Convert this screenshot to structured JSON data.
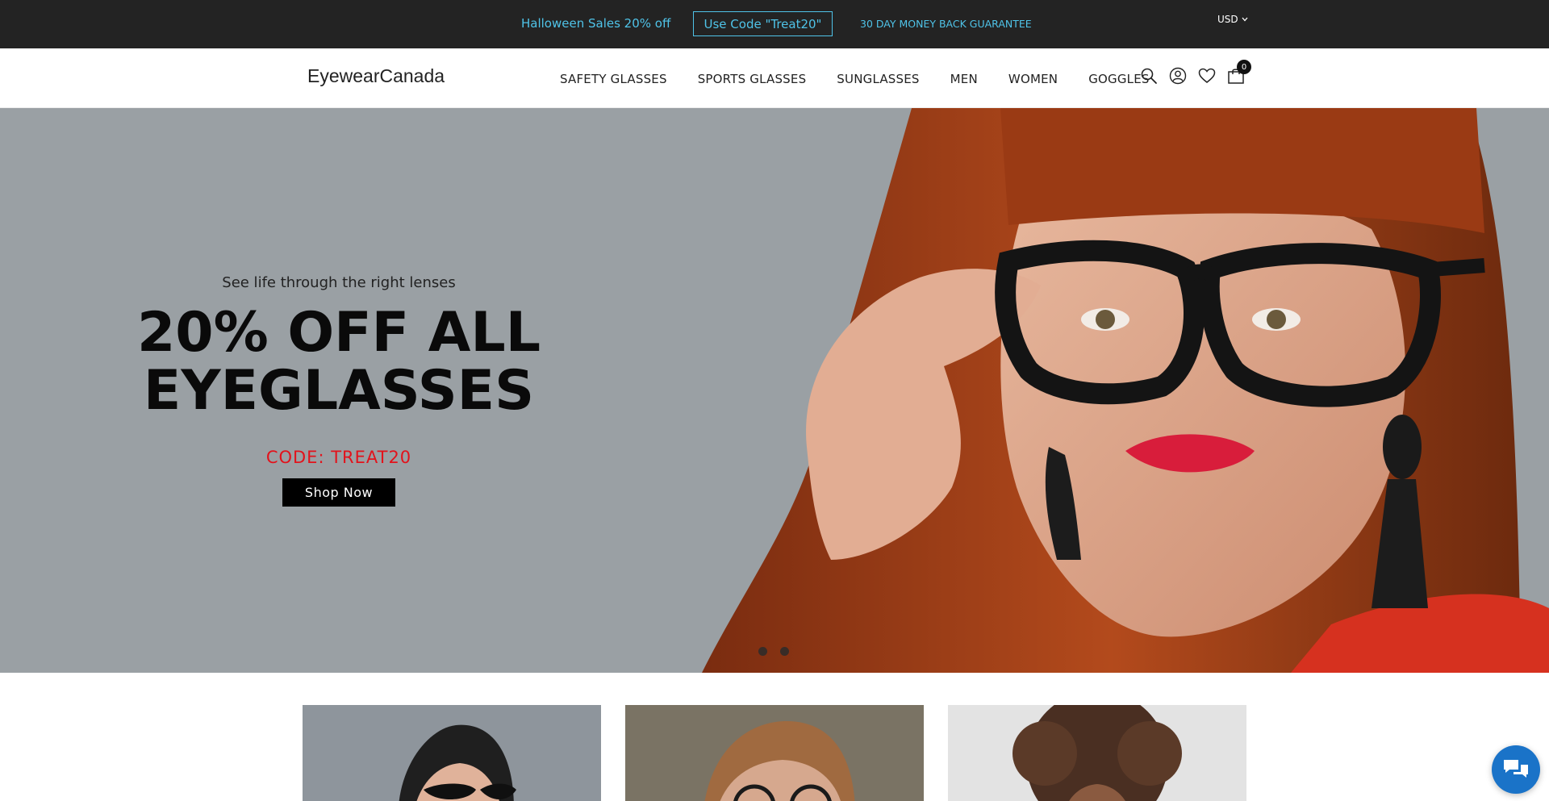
{
  "announcement": {
    "promo_text": "Halloween Sales 20% off",
    "code_label": "Use Code \"Treat20\"",
    "guarantee": "30 DAY MONEY BACK GUARANTEE",
    "currency": "USD",
    "text_color": "#4fc3e8",
    "background": "#232323"
  },
  "header": {
    "logo": "EyewearCanada",
    "nav": [
      {
        "label": "SAFETY GLASSES"
      },
      {
        "label": "SPORTS GLASSES"
      },
      {
        "label": "SUNGLASSES"
      },
      {
        "label": "MEN"
      },
      {
        "label": "WOMEN"
      },
      {
        "label": "GOGGLES"
      }
    ],
    "icons": [
      "search-icon",
      "account-icon",
      "wishlist-heart-icon",
      "cart-bag-icon"
    ],
    "cart_count": "0"
  },
  "hero": {
    "subtitle": "See life through the right lenses",
    "title_line1": "20% OFF ALL",
    "title_line2": "EYEGLASSES",
    "code": "CODE: TREAT20",
    "code_color": "#e3121b",
    "button_label": "Shop Now",
    "slides": 2,
    "background": "#9aa0a4"
  },
  "cards": [
    {
      "subject": "woman-with-cat-eye-glasses"
    },
    {
      "subject": "man-with-round-glasses"
    },
    {
      "subject": "curly-hair-person-with-glasses"
    }
  ],
  "chat": {
    "icon": "chat-bubbles-icon",
    "color": "#1a73c8"
  }
}
